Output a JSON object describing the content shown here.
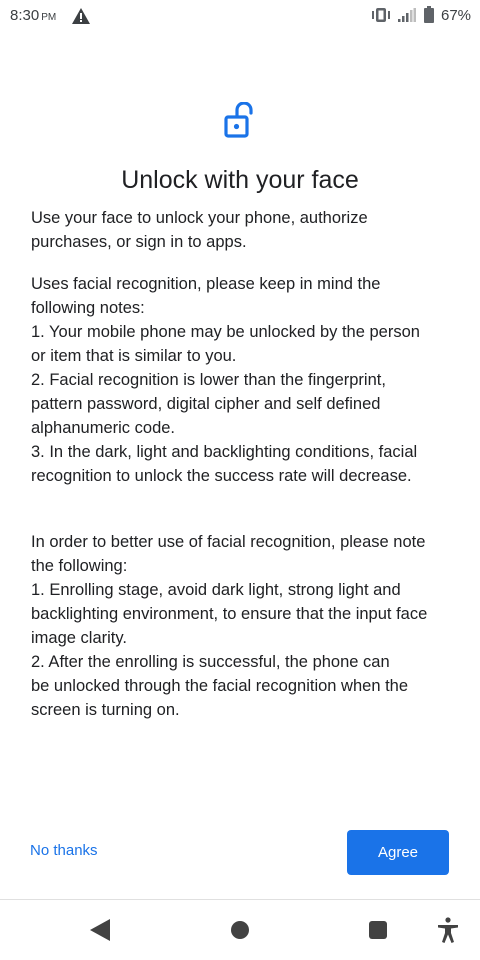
{
  "status_bar": {
    "time": "8:30",
    "ampm": "PM",
    "battery_percent": "67%",
    "icons": [
      "warning-icon",
      "vibrate-icon",
      "signal-icon",
      "battery-icon"
    ]
  },
  "main": {
    "icon": "lock-open-icon",
    "title": "Unlock with your face",
    "paragraph1": [
      "Use your face to unlock your phone, authorize",
      "purchases, or sign in to apps."
    ],
    "paragraph2": [
      "Uses facial recognition, please keep in mind the",
      "following notes:",
      "1. Your mobile phone may be unlocked by the person",
      "or item that is similar to you.",
      "2. Facial recognition is lower than the fingerprint,",
      "pattern password, digital cipher and self defined",
      "alphanumeric code.",
      "3. In the dark, light and backlighting conditions, facial",
      "recognition to unlock the success rate will decrease."
    ],
    "paragraph3": [
      "In order to better use of facial recognition, please note",
      "the following:",
      "1. Enrolling stage, avoid dark light, strong light and",
      "backlighting environment, to ensure that the input face",
      "image clarity.",
      "2. After the  enrolling is successful, the phone can",
      "be unlocked through the facial recognition when the",
      "screen is turning on."
    ]
  },
  "buttons": {
    "no_thanks": "No thanks",
    "agree": "Agree"
  },
  "nav_bar": {
    "icons": [
      "back-icon",
      "home-icon",
      "recents-icon",
      "accessibility-icon"
    ]
  },
  "colors": {
    "accent": "#1a73e8",
    "text": "#202124",
    "nav_icon": "#424242"
  }
}
